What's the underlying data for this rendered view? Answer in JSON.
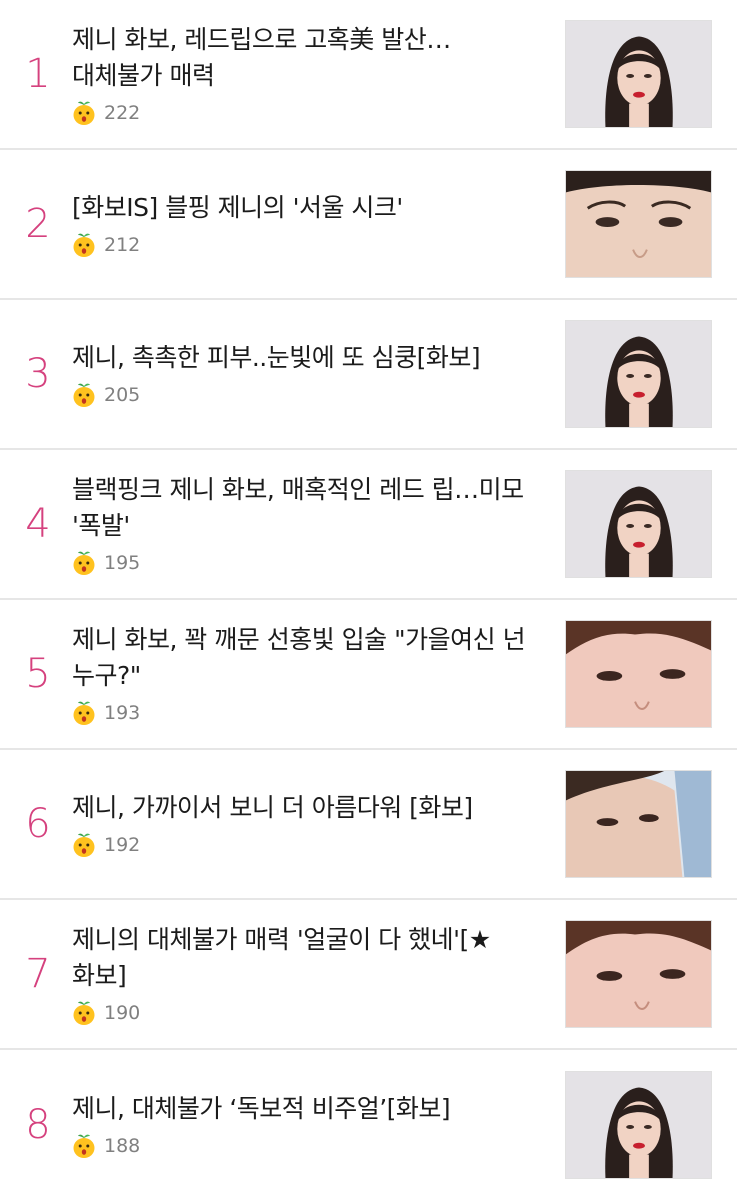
{
  "articles": [
    {
      "rank": "1",
      "title": "제니 화보, 레드립으로 고혹美 발산…대체불가 매력",
      "count": "222",
      "thumb": "portrait-red-lip"
    },
    {
      "rank": "2",
      "title": "[화보IS] 블핑 제니의 '서울 시크'",
      "count": "212",
      "thumb": "eyes-closeup"
    },
    {
      "rank": "3",
      "title": "제니, 촉촉한 피부..눈빛에 또 심쿵[화보]",
      "count": "205",
      "thumb": "portrait-red-lip"
    },
    {
      "rank": "4",
      "title": "블랙핑크 제니 화보, 매혹적인 레드 립…미모 '폭발'",
      "count": "195",
      "thumb": "portrait-red-lip"
    },
    {
      "rank": "5",
      "title": "제니 화보, 꽉 깨문 선홍빛 입술 \"가을여신 넌 누구?\"",
      "count": "193",
      "thumb": "eyes-closeup-pink"
    },
    {
      "rank": "6",
      "title": "제니, 가까이서 보니 더 아름다워 [화보]",
      "count": "192",
      "thumb": "lying-face"
    },
    {
      "rank": "7",
      "title": "제니의 대체불가 매력 '얼굴이 다 했네'[★화보]",
      "count": "190",
      "thumb": "eyes-closeup-pink"
    },
    {
      "rank": "8",
      "title": "제니, 대체불가 ‘독보적 비주얼’[화보]",
      "count": "188",
      "thumb": "portrait-red-lip"
    }
  ],
  "icons": {
    "reaction": "surprised-face-icon",
    "accent": "#d5417e"
  }
}
